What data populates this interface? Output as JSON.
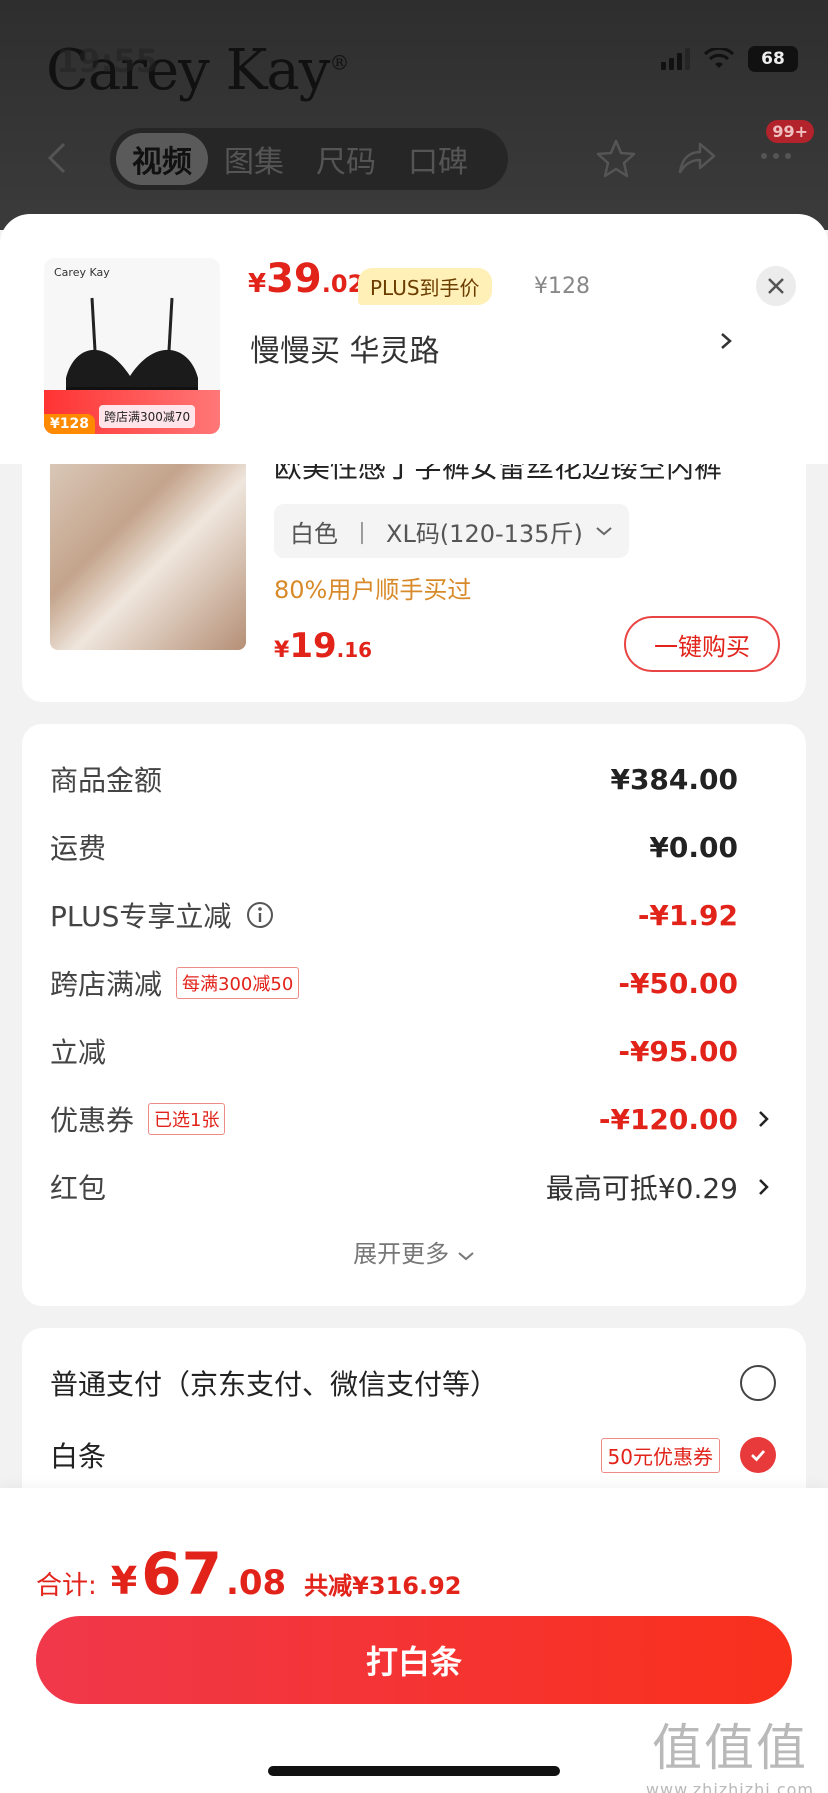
{
  "status_bar": {
    "time": "19:55",
    "battery": "68"
  },
  "brand": {
    "logo_text": "Carey Kay",
    "logo_mark": "®"
  },
  "nav": {
    "tabs": [
      "视频",
      "图集",
      "尺码",
      "口碑"
    ],
    "active_tab": 0,
    "notification_badge": "99+"
  },
  "sheet": {
    "product_thumb_brand": "Carey Kay",
    "thumb_price": "¥128",
    "thumb_promo": "跨店满300减70",
    "price_currency": "¥",
    "price_int": "39",
    "price_dec": ".02",
    "plus_tag": "PLUS到手价",
    "original_price": "¥128",
    "address": "慢慢买  华灵路"
  },
  "addon": {
    "title": "欧美性感丁字裤女雷丝花边镂空内裤",
    "spec_color": "白色",
    "spec_sep": "丨",
    "spec_size": "XL码(120-135斤)",
    "buy_hint": "80%用户顺手买过",
    "price_currency": "¥",
    "price_int": "19",
    "price_dec": ".16",
    "button_label": "一键购买"
  },
  "breakdown": {
    "rows": [
      {
        "label": "商品金额",
        "value": "¥384.00"
      },
      {
        "label": "运费",
        "value": "¥0.00"
      },
      {
        "label": "PLUS专享立减",
        "value": "-¥1.92"
      },
      {
        "label": "跨店满减",
        "tag": "每满300减50",
        "value": "-¥50.00"
      },
      {
        "label": "立减",
        "value": "-¥95.00"
      },
      {
        "label": "优惠券",
        "tag": "已选1张",
        "value": "-¥120.00"
      },
      {
        "label": "红包",
        "value": "最高可抵¥0.29"
      }
    ],
    "expand_label": "展开更多"
  },
  "payment": {
    "options": [
      {
        "label": "普通支付（京东支付、微信支付等）",
        "selected": false
      },
      {
        "label": "白条",
        "tag": "50元优惠券",
        "selected": true
      }
    ]
  },
  "footer": {
    "total_label": "合计:",
    "total_currency": "¥",
    "total_int": "67",
    "total_dec": ".08",
    "saved": "共减¥316.92",
    "pay_button": "打白条"
  },
  "watermark": {
    "big": "值值值",
    "small": "www.zhizhizhi.com"
  },
  "colors": {
    "accent_red": "#e2231a",
    "plus_yellow": "#fff0b8",
    "hint_orange": "#d88a2a"
  }
}
